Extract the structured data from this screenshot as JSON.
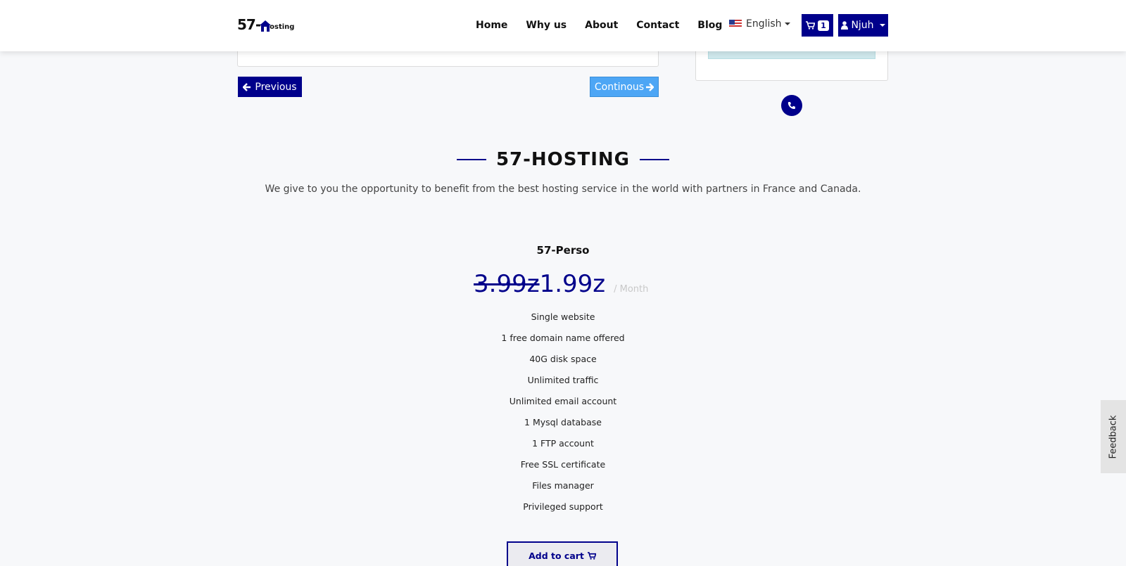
{
  "header": {
    "logo": {
      "number": "57-",
      "house_letter": "H",
      "rest": "osting"
    },
    "nav": [
      "Home",
      "Why us",
      "About",
      "Contact",
      "Blog"
    ],
    "language": {
      "label": "English",
      "flag": "us-flag-icon"
    },
    "cart": {
      "count": "1",
      "icon": "cart-icon"
    },
    "user": {
      "name": "Njuh",
      "icon": "user-icon"
    }
  },
  "form_nav": {
    "previous_label": "Previous",
    "continue_label": "Continous"
  },
  "section": {
    "title": "57-HOSTING",
    "subtitle": "We give to you the opportunity to benefit from the best hosting service in the world with partners in France and Canada."
  },
  "plan": {
    "name": "57-Perso",
    "old_price": "3.99z",
    "new_price": "1.99z",
    "period": "/ Month",
    "features": [
      "Single website",
      "1 free domain name offered",
      "40G disk space",
      "Unlimited traffic",
      "Unlimited email account",
      "1 Mysql database",
      "1 FTP account",
      "Free SSL certificate",
      "Files manager",
      "Privileged support"
    ],
    "add_to_cart_label": "Add to cart"
  },
  "feedback_label": "Feedback",
  "colors": {
    "primary": "#00008b",
    "accent": "#4da6f5",
    "background": "#f7f8fa"
  }
}
